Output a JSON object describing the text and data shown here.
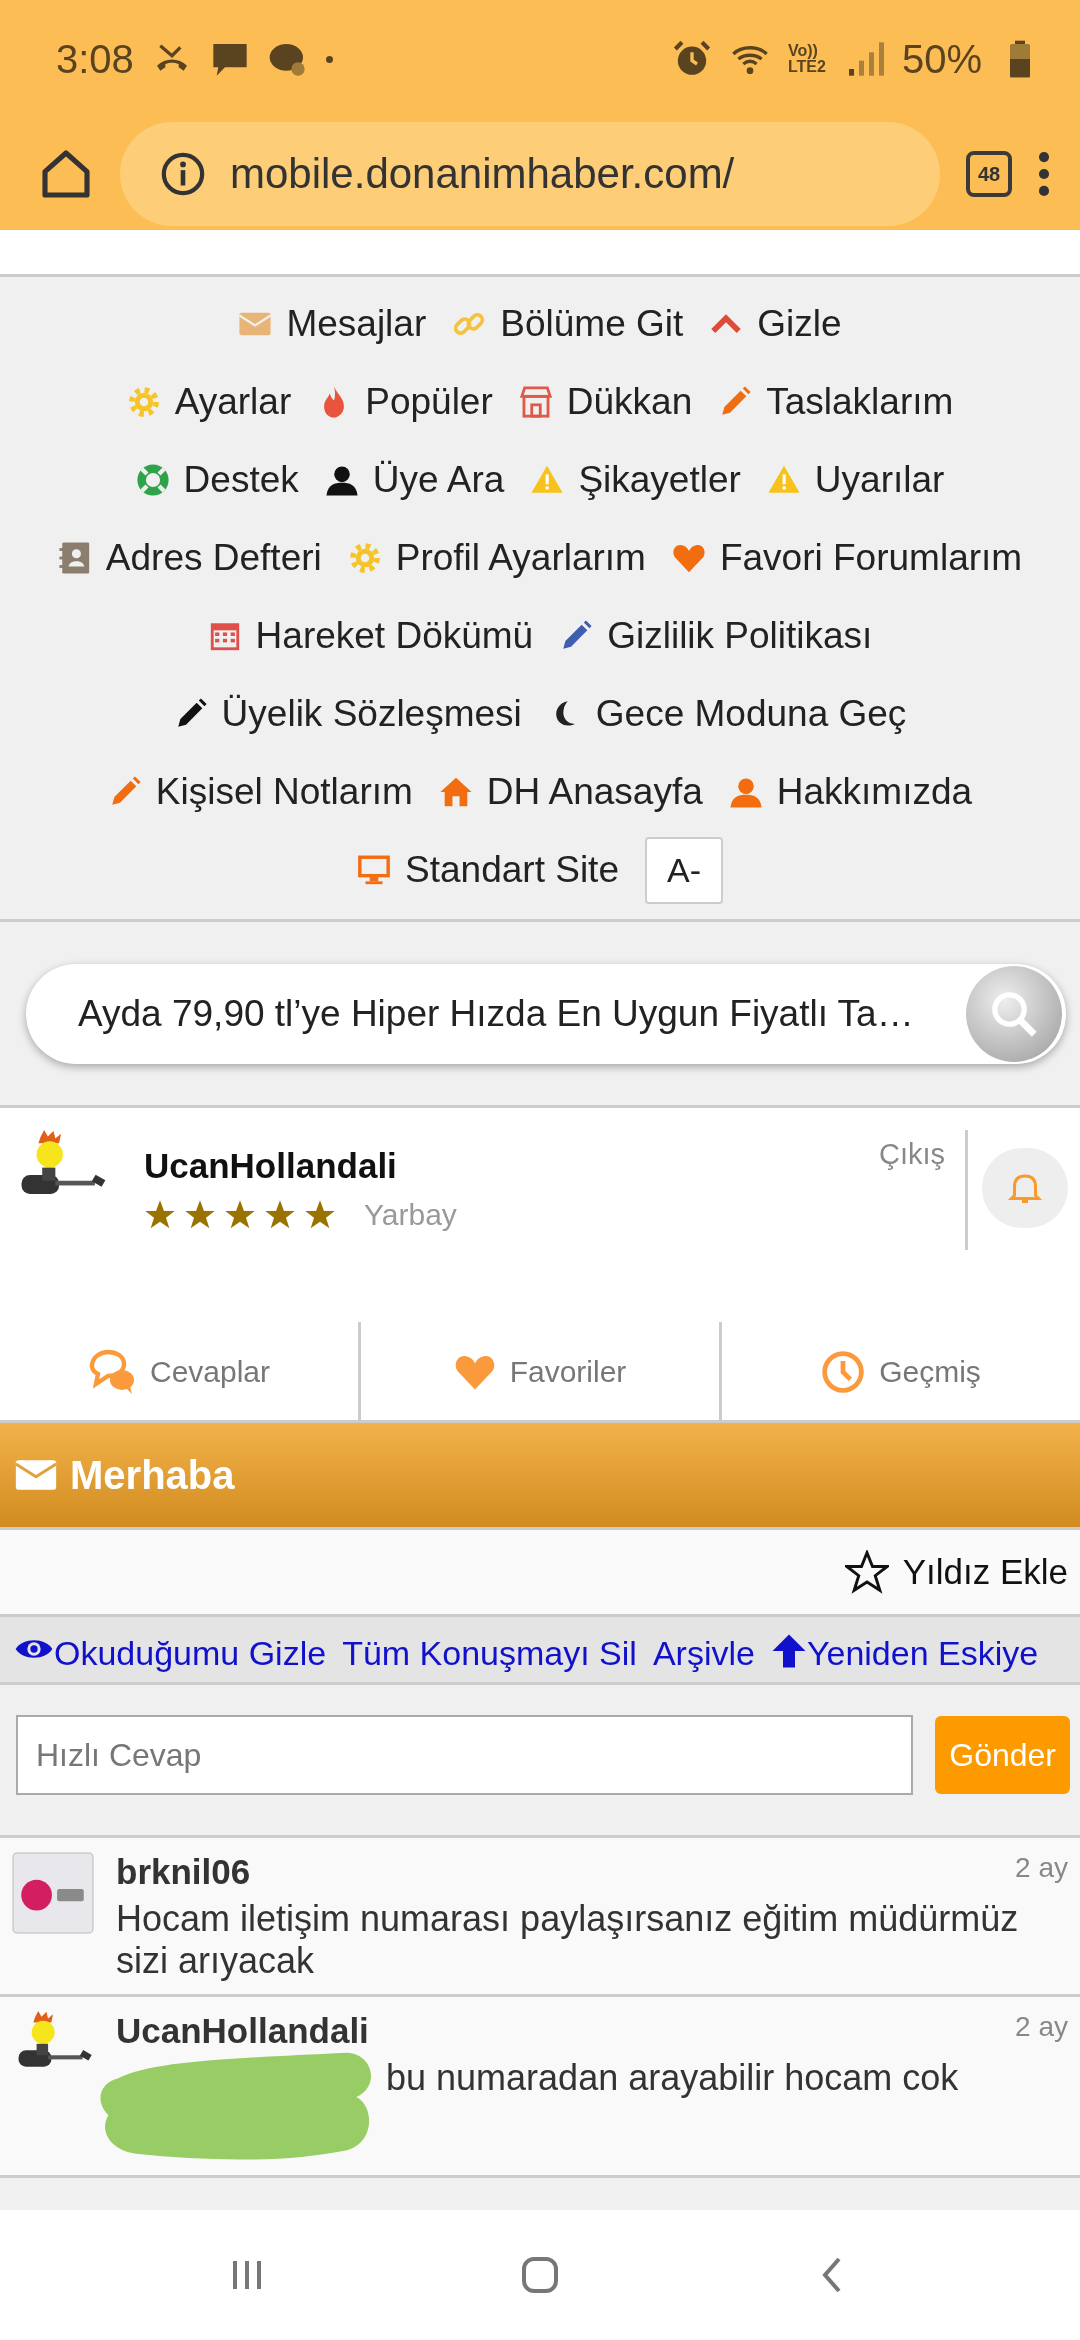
{
  "status_bar": {
    "time": "3:08",
    "volte": "Vo))",
    "lte": "LTE2",
    "battery": "50%"
  },
  "browser": {
    "url": "mobile.donanimhaber.com/",
    "tab_count": "48"
  },
  "menu_rows": [
    [
      {
        "kind": "link",
        "label": "Mesajlar"
      },
      {
        "kind": "link",
        "label": "Bölüme Git"
      },
      {
        "kind": "link",
        "label": "Gizle"
      }
    ],
    [
      {
        "kind": "link",
        "label": "Ayarlar"
      },
      {
        "kind": "link",
        "label": "Popüler"
      },
      {
        "kind": "link",
        "label": "Dükkan"
      },
      {
        "kind": "link",
        "label": "Taslaklarım"
      }
    ],
    [
      {
        "kind": "link",
        "label": "Destek"
      },
      {
        "kind": "link",
        "label": "Üye Ara"
      },
      {
        "kind": "link",
        "label": "Şikayetler"
      },
      {
        "kind": "link",
        "label": "Uyarılar"
      }
    ],
    [
      {
        "kind": "link",
        "label": "Adres Defteri"
      },
      {
        "kind": "link",
        "label": "Profil Ayarlarım"
      },
      {
        "kind": "link",
        "label": "Favori Forumlarım"
      }
    ],
    [
      {
        "kind": "link",
        "label": "Hareket Dökümü"
      },
      {
        "kind": "link",
        "label": "Gizlilik Politikası"
      }
    ],
    [
      {
        "kind": "link",
        "label": "Üyelik Sözleşmesi"
      },
      {
        "kind": "link",
        "label": "Gece Moduna Geç"
      }
    ],
    [
      {
        "kind": "link",
        "label": "Kişisel Notlarım"
      },
      {
        "kind": "link",
        "label": "DH Anasayfa"
      },
      {
        "kind": "link",
        "label": "Hakkımızda"
      }
    ],
    [
      {
        "kind": "link",
        "label": "Standart Site"
      },
      {
        "kind": "button",
        "label": "A-"
      }
    ]
  ],
  "search": {
    "value": "Ayda 79,90 tl’ye Hiper Hızda En Uygun Fiyatlı Ta…"
  },
  "user": {
    "name": "UcanHollandali",
    "stars": 5,
    "rank": "Yarbay",
    "logout": "Çıkış"
  },
  "user_tabs": [
    {
      "label": "Cevaplar"
    },
    {
      "label": "Favoriler"
    },
    {
      "label": "Geçmiş"
    }
  ],
  "conversation": {
    "title": "Merhaba",
    "star_action": "Yıldız Ekle",
    "actions": [
      {
        "label": "Okuduğumu Gizle"
      },
      {
        "label": "Tüm Konuşmayı Sil"
      },
      {
        "label": "Arşivle"
      },
      {
        "label": "Yeniden Eskiye"
      }
    ],
    "reply": {
      "placeholder": "Hızlı Cevap",
      "send": "Gönder"
    },
    "messages": [
      {
        "kind": "logo",
        "author": "brknil06",
        "time": "2 ay",
        "text": "Hocam iletişim numarası paylaşırsanız eğitim müdürmüz sizi arıyacak",
        "redacted": false
      },
      {
        "kind": "figure",
        "author": "UcanHollandali",
        "time": "2 ay",
        "text": "bu numaradan arayabilir hocam cok",
        "redacted": true
      }
    ]
  }
}
